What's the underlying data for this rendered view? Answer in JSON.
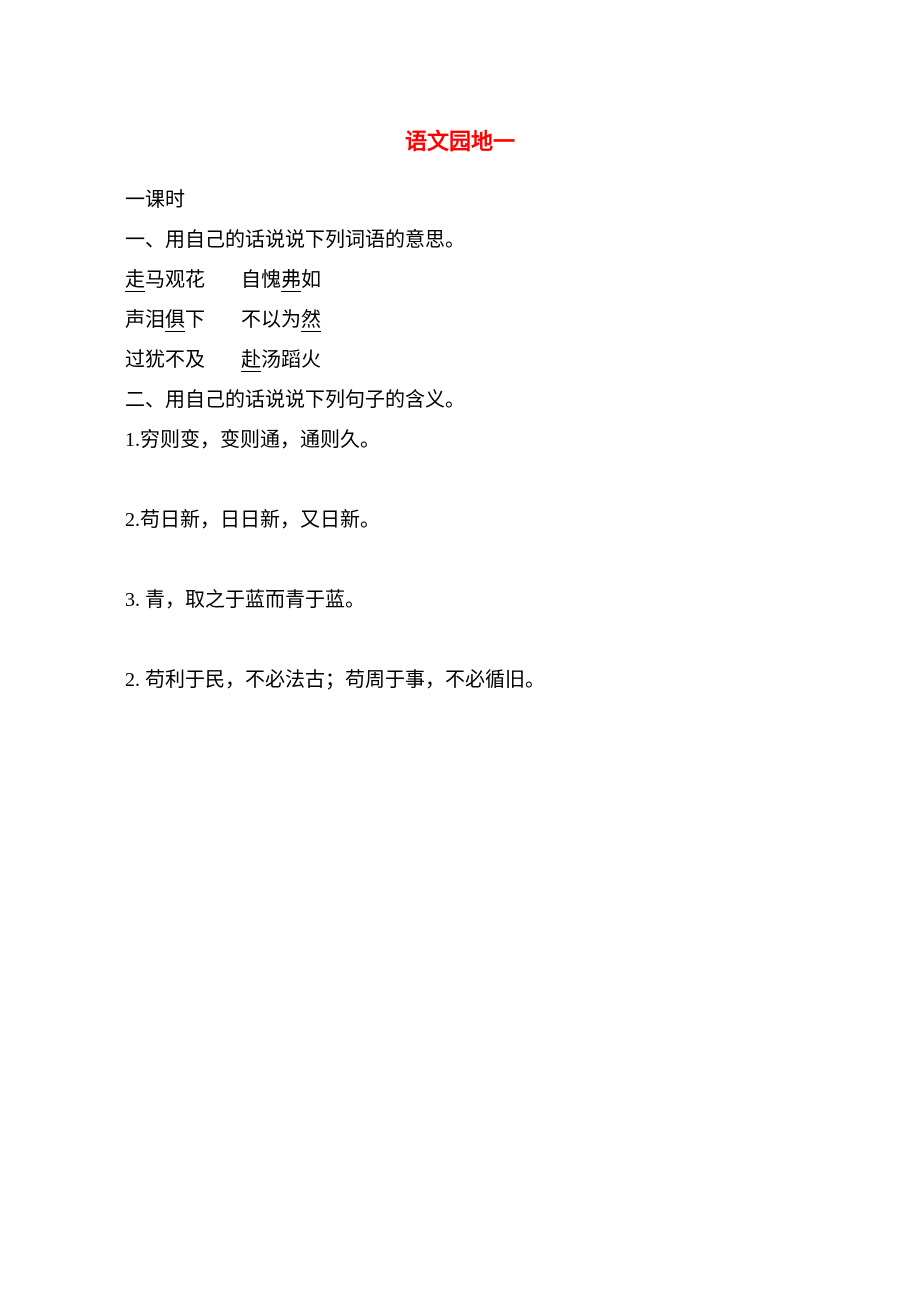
{
  "title": "语文园地一",
  "lesson": "一课时",
  "section1": {
    "heading": "一、用自己的话说说下列词语的意思。",
    "row1_pre1": "走",
    "row1_post1": "马观花",
    "row1_pre2": "自愧",
    "row1_u2": "弗",
    "row1_post2": "如",
    "row2_pre1": "声泪",
    "row2_u1": "俱",
    "row2_post1": "下",
    "row2_pre2": "不以为",
    "row2_u2": "然",
    "row3_text1": "过犹不及",
    "row3_u2": "赴",
    "row3_post2": "汤蹈火"
  },
  "section2": {
    "heading": "二、用自己的话说说下列句子的含义。",
    "q1": "1.穷则变，变则通，通则久。",
    "q2": "2.苟日新，日日新，又日新。",
    "q3": "3. 青，取之于蓝而青于蓝。",
    "q4": "2. 苟利于民，不必法古；苟周于事，不必循旧。"
  }
}
